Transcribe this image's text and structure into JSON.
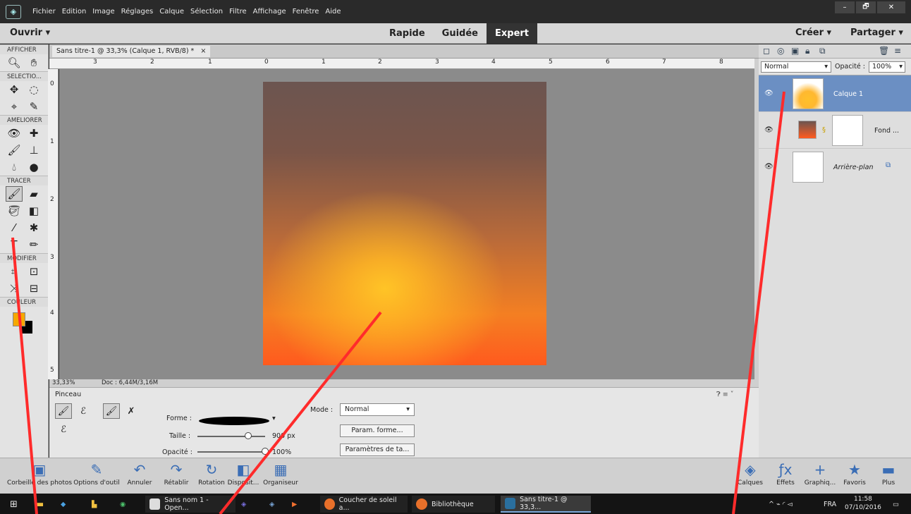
{
  "menubar": {
    "items": [
      "Fichier",
      "Edition",
      "Image",
      "Réglages",
      "Calque",
      "Sélection",
      "Filtre",
      "Affichage",
      "Fenêtre",
      "Aide"
    ],
    "window_buttons": [
      "–",
      "🗗",
      "✕"
    ]
  },
  "modebar": {
    "open": "Ouvrir ▾",
    "tabs": [
      "Rapide",
      "Guidée",
      "Expert"
    ],
    "active_tab": "Expert",
    "create": "Créer ▾",
    "share": "Partager ▾"
  },
  "toolbox": {
    "sections": [
      "AFFICHER",
      "SELECTIO...",
      "AMELIORER",
      "TRACER",
      "MODIFIER",
      "COULEUR"
    ],
    "foreground": "#f5a800",
    "background": "#000000"
  },
  "document": {
    "tab_title": "Sans titre-1 @ 33,3% (Calque 1, RVB/8) *",
    "tab_close": "×",
    "zoom": "33,33%",
    "doc_size": "Doc : 6,44M/3,16M",
    "ruler_h": [
      "3",
      "2",
      "1",
      "0",
      "1",
      "2",
      "3",
      "4",
      "5",
      "6",
      "7",
      "8"
    ],
    "ruler_v": [
      "0",
      "1",
      "2",
      "3",
      "4",
      "5"
    ]
  },
  "options": {
    "title": "Pinceau",
    "shape_label": "Forme :",
    "size_label": "Taille :",
    "size_value": "900 px",
    "size_fraction": 0.75,
    "opacity_label": "Opacité :",
    "opacity_value": "100%",
    "opacity_fraction": 1.0,
    "mode_label": "Mode :",
    "mode_value": "Normal",
    "param_shape": "Param. forme...",
    "param_tablet": "Paramètres de ta..."
  },
  "layers_panel": {
    "blend_mode": "Normal",
    "opacity_label": "Opacité :",
    "opacity_value": "100%",
    "layers": [
      {
        "name": "Calque 1",
        "selected": true
      },
      {
        "name": "Fond ...",
        "selected": false
      },
      {
        "name": "Arrière-plan",
        "selected": false
      }
    ]
  },
  "bottombar": {
    "left": [
      "Corbeille des photos",
      "Options d'outil",
      "Annuler",
      "Rétablir",
      "Rotation",
      "Disposit...",
      "Organiseur"
    ],
    "right": [
      "Calques",
      "Effets",
      "Graphiq...",
      "Favoris",
      "Plus"
    ]
  },
  "taskbar": {
    "items": [
      "Sans nom 1 - Open...",
      "Coucher de soleil a...",
      "Bibliothèque",
      "Sans titre-1 @ 33,3..."
    ],
    "lang": "FRA",
    "time": "11:58",
    "date": "07/10/2016"
  },
  "colors": {
    "annotation": "#ff2b2b",
    "selection": "#6b8fc3"
  }
}
